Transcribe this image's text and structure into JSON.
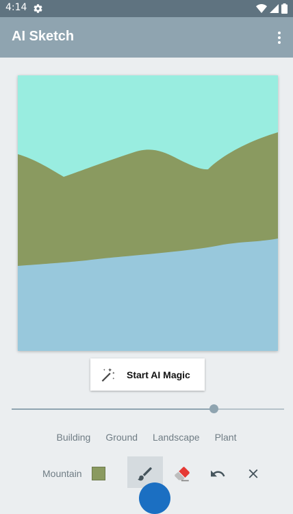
{
  "status_bar": {
    "time": "4:14"
  },
  "app_bar": {
    "title": "AI Sketch"
  },
  "canvas": {
    "colors": {
      "sky": "#99ede0",
      "mountain": "#8a9a60",
      "water": "#98c8dc"
    }
  },
  "magic_button": {
    "label": "Start AI Magic",
    "icon": "magic-wand-icon"
  },
  "brush_size": {
    "value_fraction": 0.74
  },
  "categories": [
    "Building",
    "Ground",
    "Landscape",
    "Plant"
  ],
  "toolbar": {
    "current_label": "Mountain",
    "current_color": "#8a9a60",
    "tools": [
      "brush-icon",
      "eraser-icon",
      "undo-icon",
      "close-icon"
    ],
    "selected_tool": "brush-icon"
  },
  "colors": {
    "status_bar": "#5f7380",
    "app_bar": "#8fa4b0",
    "background": "#ebeef0",
    "accent": "#1b6fc2"
  }
}
